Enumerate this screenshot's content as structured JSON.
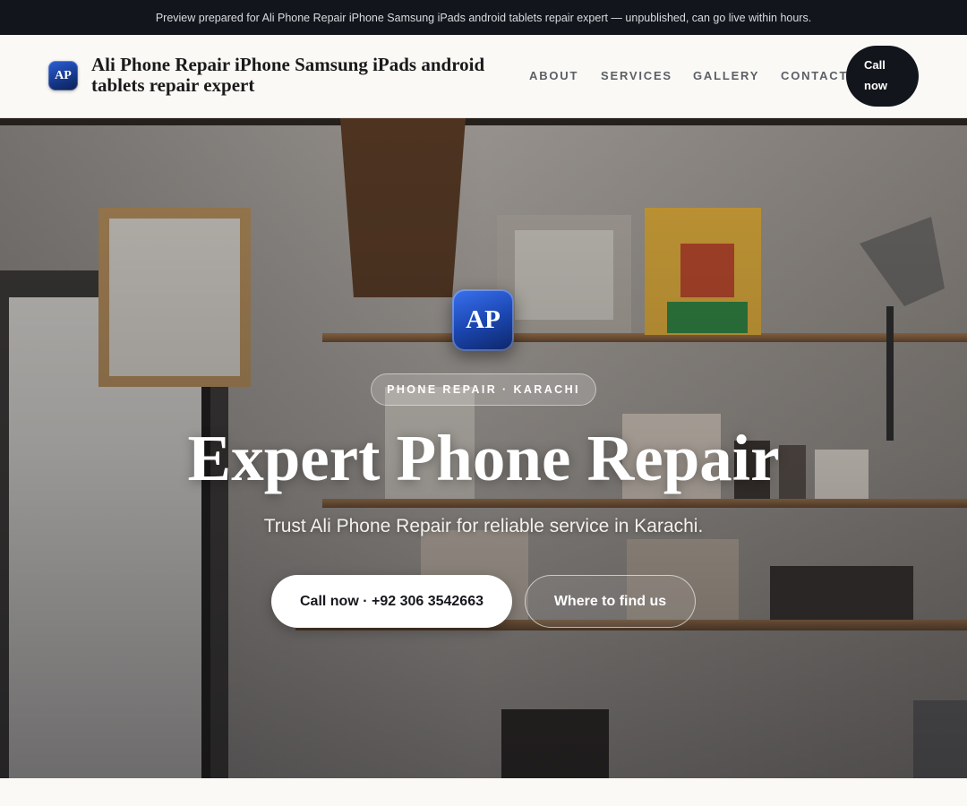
{
  "preview_banner": "Preview prepared for Ali Phone Repair iPhone Samsung iPads android tablets repair expert — unpublished, can go live within hours.",
  "header": {
    "logo_initials": "AP",
    "brand_name": "Ali Phone Repair iPhone Samsung iPads android tablets repair expert",
    "nav": {
      "about": "ABOUT",
      "services": "SERVICES",
      "gallery": "GALLERY",
      "contact": "CONTACT"
    },
    "cta_label": "Call now"
  },
  "hero": {
    "logo_initials": "AP",
    "eyebrow": "PHONE REPAIR · KARACHI",
    "title": "Expert Phone Repair",
    "subtitle": "Trust Ali Phone Repair for reliable service in Karachi.",
    "primary_button": "Call now · +92 306 3542663",
    "secondary_button": "Where to find us"
  },
  "colors": {
    "banner_bg": "#12151b",
    "accent_blue": "#1c48b4",
    "page_bg": "#faf9f6"
  }
}
